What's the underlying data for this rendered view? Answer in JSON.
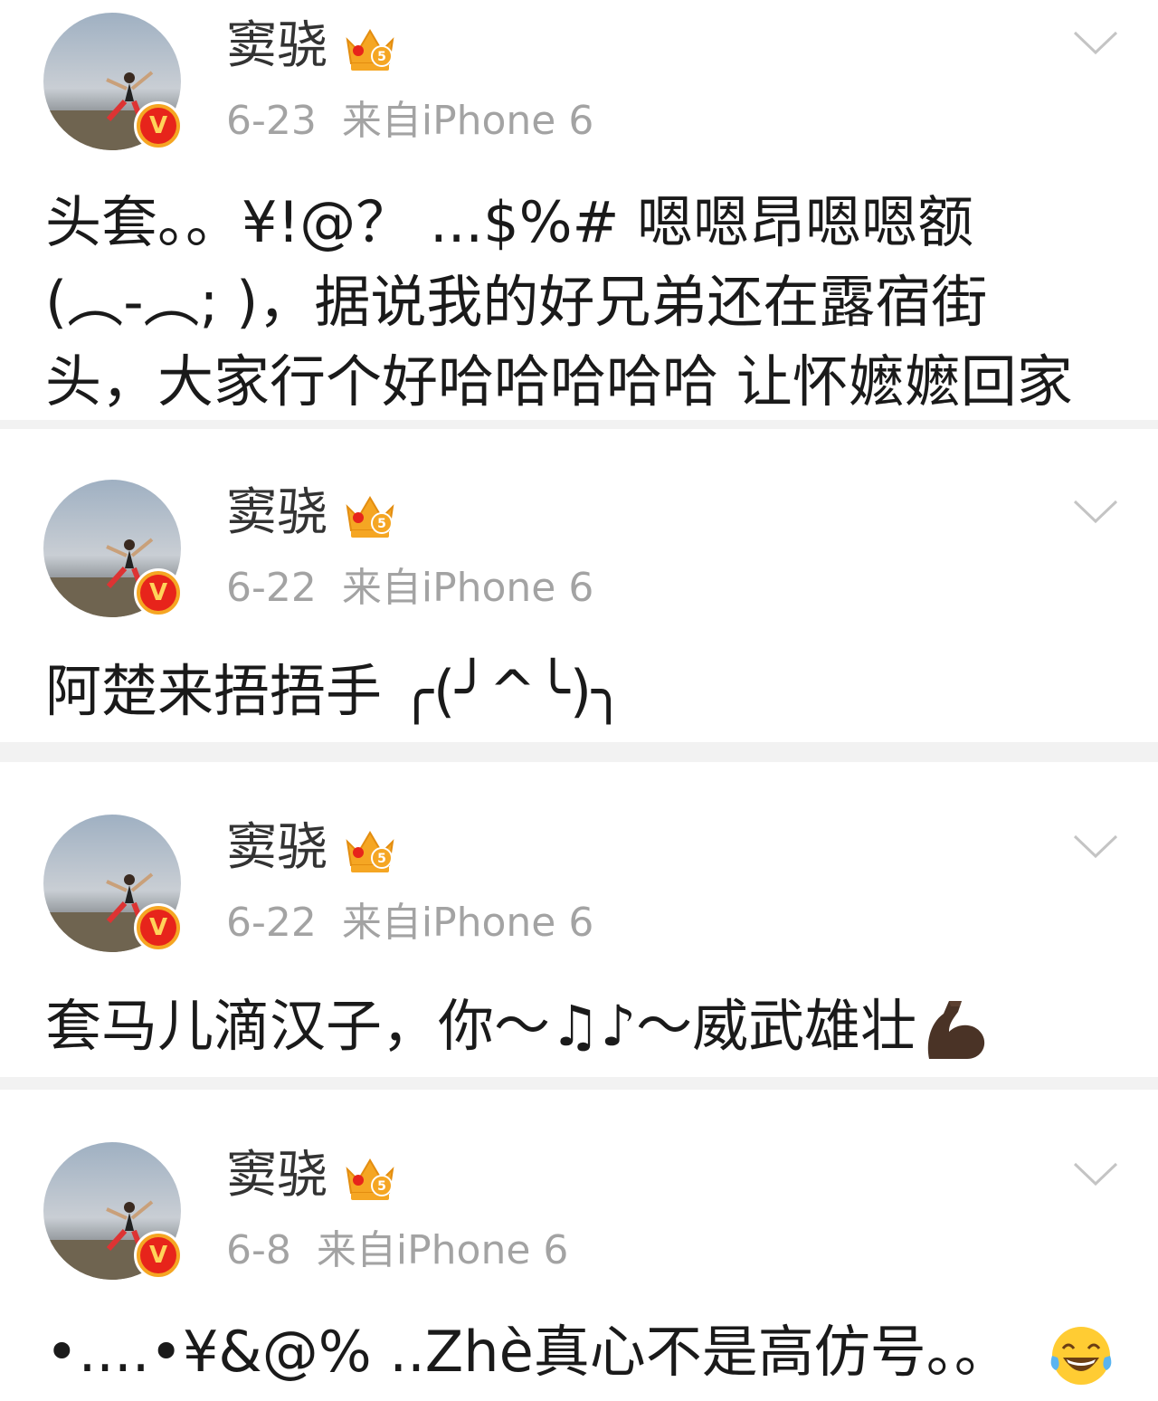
{
  "colors": {
    "background": "#f2f2f2",
    "card": "#ffffff",
    "username": "#333333",
    "meta": "#a3a3a3",
    "content": "#1a1a1a",
    "verified_badge": "#e7241b",
    "crown": "#f5a623"
  },
  "posts": [
    {
      "username": "窦骁",
      "date": "6-23",
      "source": "来自iPhone 6",
      "content_lines": [
        "头套。。¥!@？ ...$%# 嗯嗯昂嗯嗯额",
        "(︵-︵; )，据说我的好兄弟还在露宿街",
        "头，大家行个好哈哈哈哈哈 让怀嬷嬷回家"
      ],
      "icons": [
        "avatar",
        "verified-badge-icon",
        "vip-crown-icon",
        "chevron-down-icon"
      ]
    },
    {
      "username": "窦骁",
      "date": "6-22",
      "source": "来自iPhone 6",
      "content_lines": [
        "阿楚来捂捂手 ╭(╯^╰)╮"
      ],
      "icons": [
        "avatar",
        "verified-badge-icon",
        "vip-crown-icon",
        "chevron-down-icon"
      ]
    },
    {
      "username": "窦骁",
      "date": "6-22",
      "source": "来自iPhone 6",
      "content_lines": [
        "套马儿滴汉子，你〜♫♪〜威武雄壮"
      ],
      "icons": [
        "avatar",
        "verified-badge-icon",
        "vip-crown-icon",
        "chevron-down-icon",
        "flexed-biceps-emoji"
      ]
    },
    {
      "username": "窦骁",
      "date": "6-8",
      "source": "来自iPhone 6",
      "content_lines": [
        "•....•¥&@% ..Zhè真心不是高仿号。。"
      ],
      "icons": [
        "avatar",
        "verified-badge-icon",
        "vip-crown-icon",
        "chevron-down-icon",
        "tears-of-joy-emoji"
      ]
    }
  ]
}
